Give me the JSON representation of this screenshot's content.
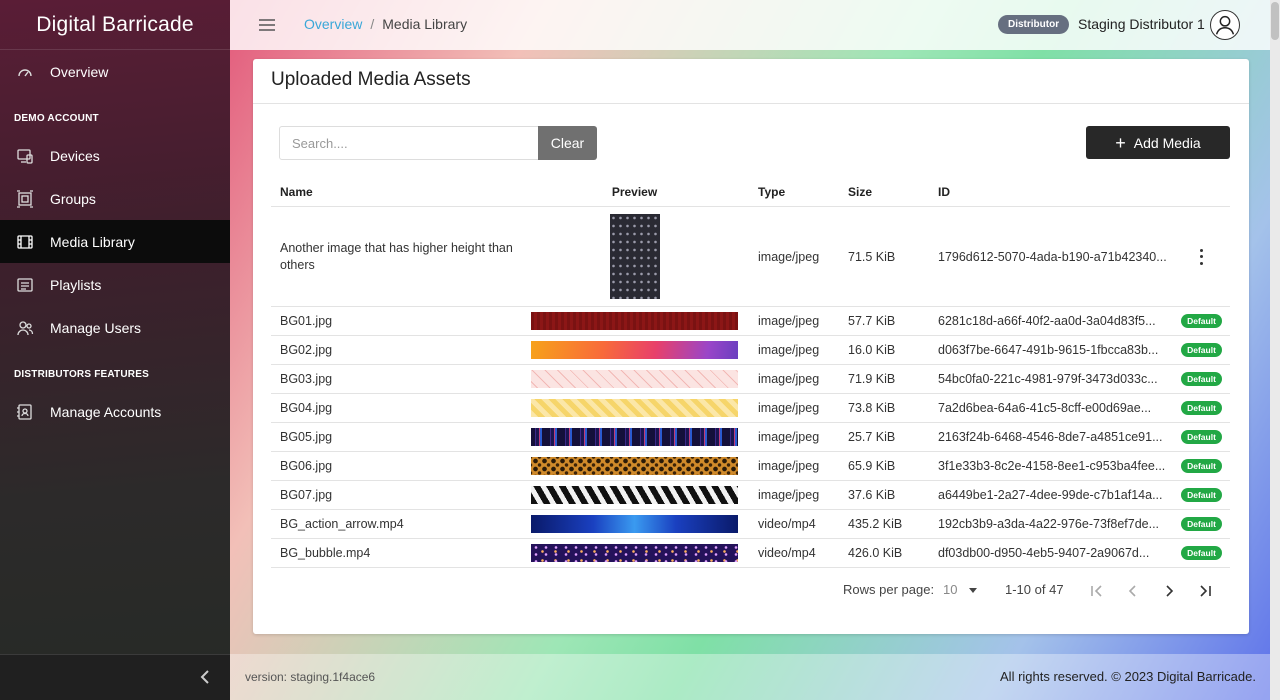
{
  "brand": "Digital Barricade",
  "sidebar": {
    "overview": "Overview",
    "section_demo": "DEMO ACCOUNT",
    "devices": "Devices",
    "groups": "Groups",
    "media_library": "Media Library",
    "playlists": "Playlists",
    "manage_users": "Manage Users",
    "section_distributors": "DISTRIBUTORS FEATURES",
    "manage_accounts": "Manage Accounts"
  },
  "topbar": {
    "breadcrumb_overview": "Overview",
    "breadcrumb_sep": "/",
    "breadcrumb_current": "Media Library",
    "role_badge": "Distributor",
    "user_name": "Staging Distributor 1"
  },
  "card": {
    "title": "Uploaded Media Assets",
    "search_placeholder": "Search....",
    "clear_label": "Clear",
    "add_label": "Add Media"
  },
  "table": {
    "headers": {
      "name": "Name",
      "preview": "Preview",
      "type": "Type",
      "size": "Size",
      "id": "ID"
    },
    "rows": [
      {
        "name": "Another image that has higher height than others",
        "type": "image/jpeg",
        "size": "71.5 KiB",
        "id": "1796d612-5070-4ada-b190-a71b42340...",
        "badge": ""
      },
      {
        "name": "BG01.jpg",
        "type": "image/jpeg",
        "size": "57.7 KiB",
        "id": "6281c18d-a66f-40f2-aa0d-3a04d83f5...",
        "badge": "Default"
      },
      {
        "name": "BG02.jpg",
        "type": "image/jpeg",
        "size": "16.0 KiB",
        "id": "d063f7be-6647-491b-9615-1fbcca83b...",
        "badge": "Default"
      },
      {
        "name": "BG03.jpg",
        "type": "image/jpeg",
        "size": "71.9 KiB",
        "id": "54bc0fa0-221c-4981-979f-3473d033c...",
        "badge": "Default"
      },
      {
        "name": "BG04.jpg",
        "type": "image/jpeg",
        "size": "73.8 KiB",
        "id": "7a2d6bea-64a6-41c5-8cff-e00d69ae...",
        "badge": "Default"
      },
      {
        "name": "BG05.jpg",
        "type": "image/jpeg",
        "size": "25.7 KiB",
        "id": "2163f24b-6468-4546-8de7-a4851ce91...",
        "badge": "Default"
      },
      {
        "name": "BG06.jpg",
        "type": "image/jpeg",
        "size": "65.9 KiB",
        "id": "3f1e33b3-8c2e-4158-8ee1-c953ba4fee...",
        "badge": "Default"
      },
      {
        "name": "BG07.jpg",
        "type": "image/jpeg",
        "size": "37.6 KiB",
        "id": "a6449be1-2a27-4dee-99de-c7b1af14a...",
        "badge": "Default"
      },
      {
        "name": "BG_action_arrow.mp4",
        "type": "video/mp4",
        "size": "435.2 KiB",
        "id": "192cb3b9-a3da-4a22-976e-73f8ef7de...",
        "badge": "Default"
      },
      {
        "name": "BG_bubble.mp4",
        "type": "video/mp4",
        "size": "426.0 KiB",
        "id": "df03db00-d950-4eb5-9407-2a9067d...",
        "badge": "Default"
      }
    ]
  },
  "pagination": {
    "rows_per_page_label": "Rows per page:",
    "rows_per_page_value": "10",
    "range": "1-10 of 47"
  },
  "footer": {
    "version": "version: staging.1f4ace6",
    "copyright": "All rights reserved. © 2023 Digital Barricade."
  },
  "colors": {
    "accent_link": "#3aa7d8",
    "default_badge": "#22a845",
    "sidebar_active": "#0c0c0c"
  }
}
